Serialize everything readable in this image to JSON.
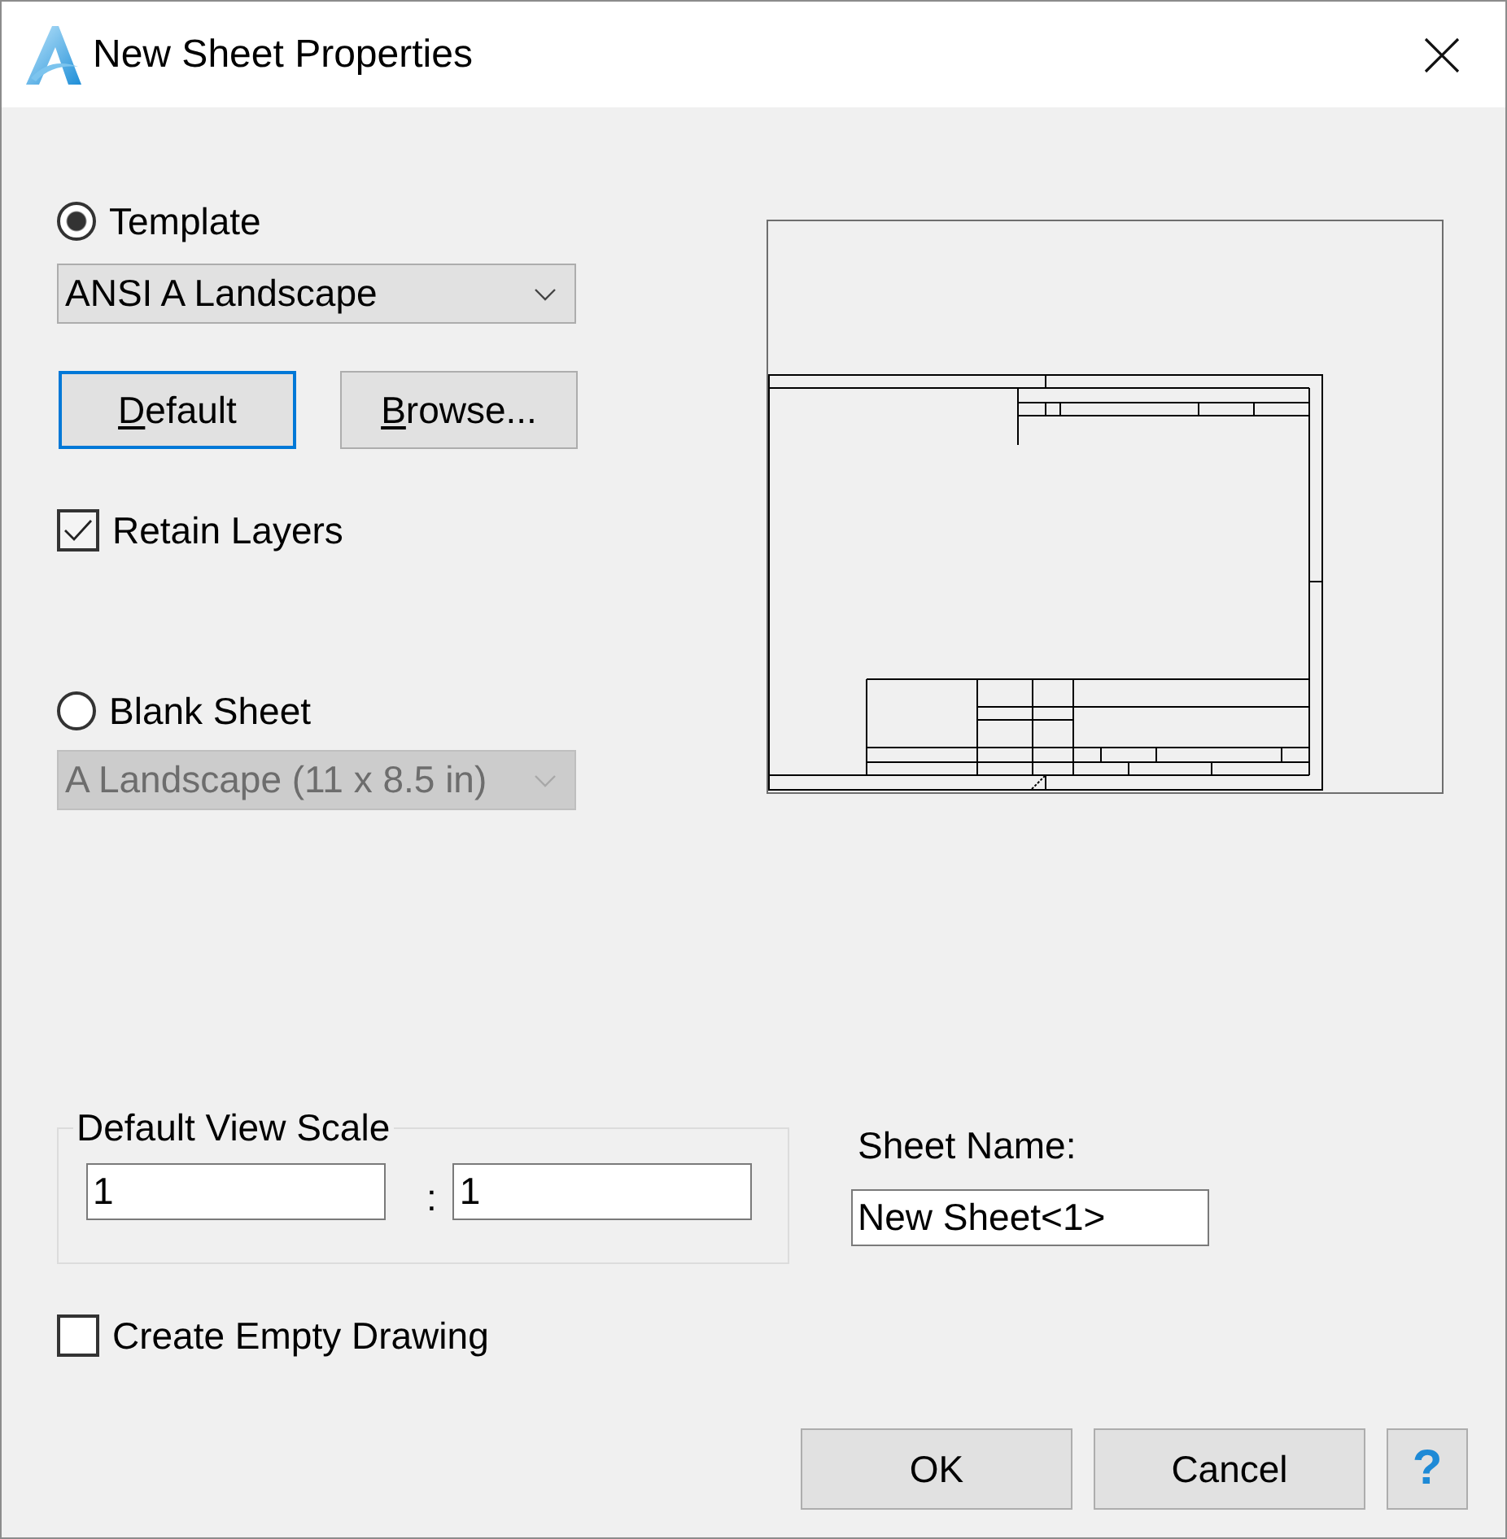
{
  "window": {
    "title": "New Sheet Properties"
  },
  "template": {
    "label": "Template",
    "selected": true,
    "dropdown": {
      "value": "ANSI A Landscape",
      "disabled": false
    },
    "buttons": [
      {
        "label": "Default",
        "focused": true,
        "access_key_underlined": true
      },
      {
        "label": "Browse...",
        "focused": false,
        "access_key_underlined": true
      }
    ],
    "retain_layers": {
      "label": "Retain Layers",
      "checked": true
    }
  },
  "blank_sheet": {
    "label": "Blank Sheet",
    "selected": false,
    "dropdown": {
      "value": "A Landscape (11 x 8.5 in)",
      "disabled": true
    }
  },
  "default_view_scale": {
    "label": "Default View Scale",
    "left": {
      "value": "1"
    },
    "separator": ":",
    "right": {
      "value": "1"
    }
  },
  "sheet_name": {
    "label": "Sheet Name:",
    "value": "New Sheet<1>"
  },
  "create_empty_drawing": {
    "label": "Create Empty Drawing",
    "checked": false
  },
  "buttons": [
    {
      "kind": "text",
      "label": "OK"
    },
    {
      "kind": "text",
      "label": "Cancel"
    },
    {
      "kind": "help",
      "label": "?"
    }
  ]
}
